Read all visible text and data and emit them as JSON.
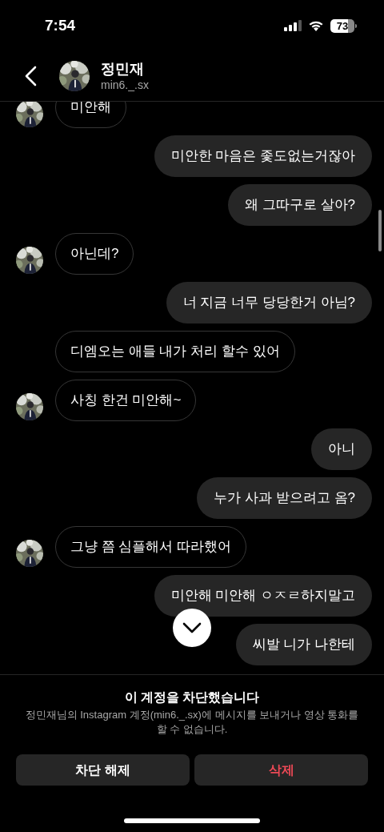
{
  "status_bar": {
    "time": "7:54",
    "battery": "73"
  },
  "header": {
    "name": "정민재",
    "username": "min6._.sx"
  },
  "messages": [
    {
      "kind": "received",
      "avatar": true,
      "text": "미안해"
    },
    {
      "kind": "sent",
      "text": "미안한 마음은 좇도없는거잖아"
    },
    {
      "kind": "sent",
      "text": "왜 그따구로 살아?"
    },
    {
      "kind": "received",
      "avatar": true,
      "text": "아닌데?"
    },
    {
      "kind": "sent",
      "text": "너 지금 너무 당당한거 아님?"
    },
    {
      "kind": "received",
      "avatar": false,
      "text": "디엠오는 애들 내가 처리 할수 있어"
    },
    {
      "kind": "received",
      "avatar": true,
      "text": "사칭 한건 미안해~"
    },
    {
      "kind": "sent",
      "text": "아니"
    },
    {
      "kind": "sent",
      "text": "누가 사과 받으려고 옴?"
    },
    {
      "kind": "received",
      "avatar": true,
      "text": "그냥 쯤 심플해서 따라했어"
    },
    {
      "kind": "sent",
      "text": "미안해 미안해 ㅇㅈㄹ하지말고"
    },
    {
      "kind": "sent",
      "text": "씨발 니가 나한테"
    }
  ],
  "blocked_notice": {
    "title": "이 계정을 차단했습니다",
    "description": "정민재님의 Instagram 계정(min6._.sx)에 메시지를 보내거나 영상 통화를 할 수 없습니다.",
    "buttons": [
      {
        "label": "차단 해제",
        "kind": "neutral"
      },
      {
        "label": "삭제",
        "kind": "destructive"
      }
    ]
  }
}
